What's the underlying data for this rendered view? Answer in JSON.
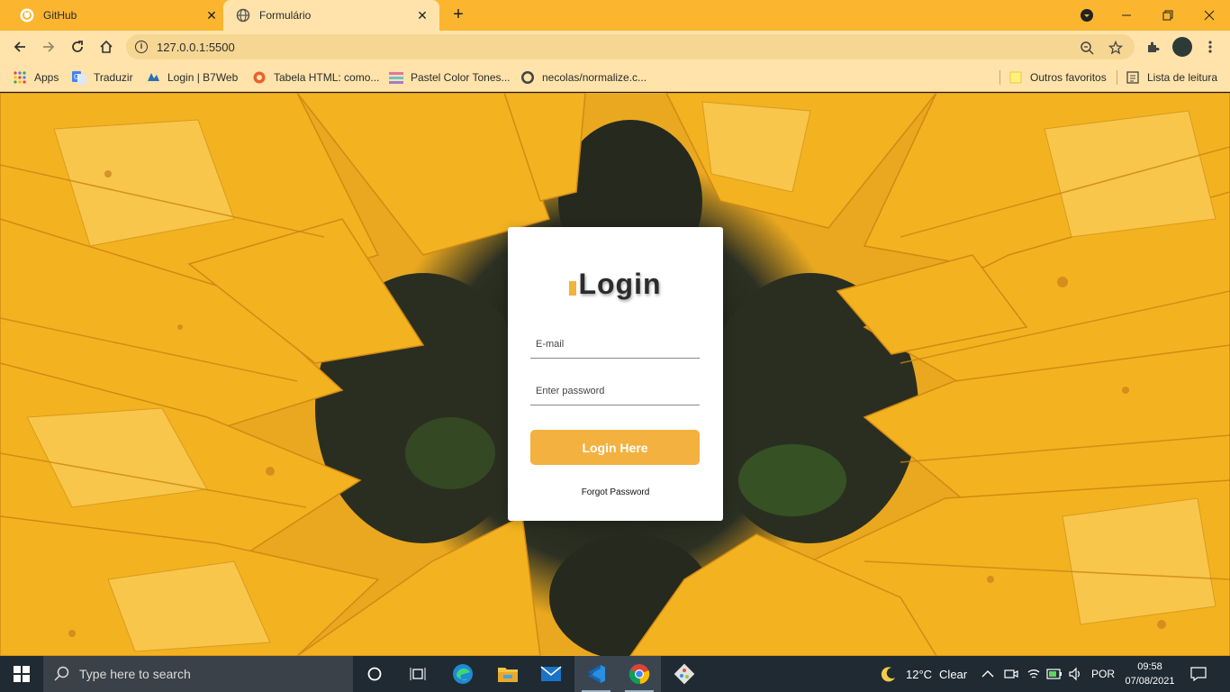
{
  "browser": {
    "tabs": [
      {
        "label": "GitHub",
        "icon": "github-icon",
        "active": false
      },
      {
        "label": "Formulário",
        "icon": "globe-icon",
        "active": true
      }
    ],
    "url": "127.0.0.1:5500",
    "bookmarks": [
      {
        "label": "Apps",
        "icon": "apps-grid-icon"
      },
      {
        "label": "Traduzir",
        "icon": "google-translate-icon"
      },
      {
        "label": "Login | B7Web",
        "icon": "b7web-icon"
      },
      {
        "label": "Tabela HTML: como...",
        "icon": "html-site-icon"
      },
      {
        "label": "Pastel Color Tones...",
        "icon": "palette-icon"
      },
      {
        "label": "necolas/normalize.c...",
        "icon": "github-icon"
      }
    ],
    "other_bookmarks": "Outros favoritos",
    "reading_list": "Lista de leitura",
    "accent_color": "#fbb52f"
  },
  "login": {
    "title": "Login",
    "email_placeholder": "E-mail",
    "password_placeholder": "Enter password",
    "button_label": "Login Here",
    "forgot_label": "Forgot Password",
    "button_color": "#f3b13f"
  },
  "taskbar": {
    "search_placeholder": "Type here to search",
    "weather_temp": "12°C",
    "weather_desc": "Clear",
    "language": "POR",
    "time": "09:58",
    "date": "07/08/2021"
  }
}
